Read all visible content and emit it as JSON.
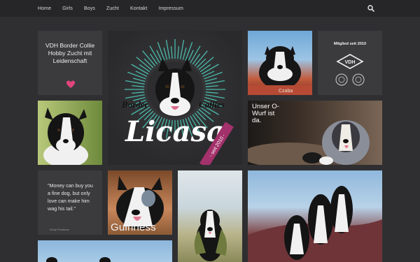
{
  "nav": {
    "items": [
      "Home",
      "Girls",
      "Boys",
      "Zucht",
      "Kontakt",
      "Impressum"
    ],
    "search_icon": "search-icon"
  },
  "tagline": {
    "text": "VDH Border Collie Hobby Zucht mit Leidenschaft",
    "heart_color": "#e0457b"
  },
  "logo": {
    "top_left": "Border",
    "top_right": "Collies",
    "name": "Licasa",
    "ribbon": "- seit 2010 -",
    "ray_color": "#4fd2c0",
    "ribbon_color": "#a3316b"
  },
  "member": {
    "text": "Mitglied seit 2010",
    "badge": "VDH"
  },
  "wurf": {
    "text": "Unser O-Wurf ist da."
  },
  "quote": {
    "text": "\"Money can buy you a fine dog, but only love can make him wag his tail.\"",
    "author": "Kinky Friedman"
  },
  "photos": {
    "guinness": "Guinness",
    "dog_name_plate": "Czaba"
  },
  "colors": {
    "page_bg": "#2f2f31",
    "nav_bg": "#262628",
    "tile_bg": "#3b3b3e"
  }
}
